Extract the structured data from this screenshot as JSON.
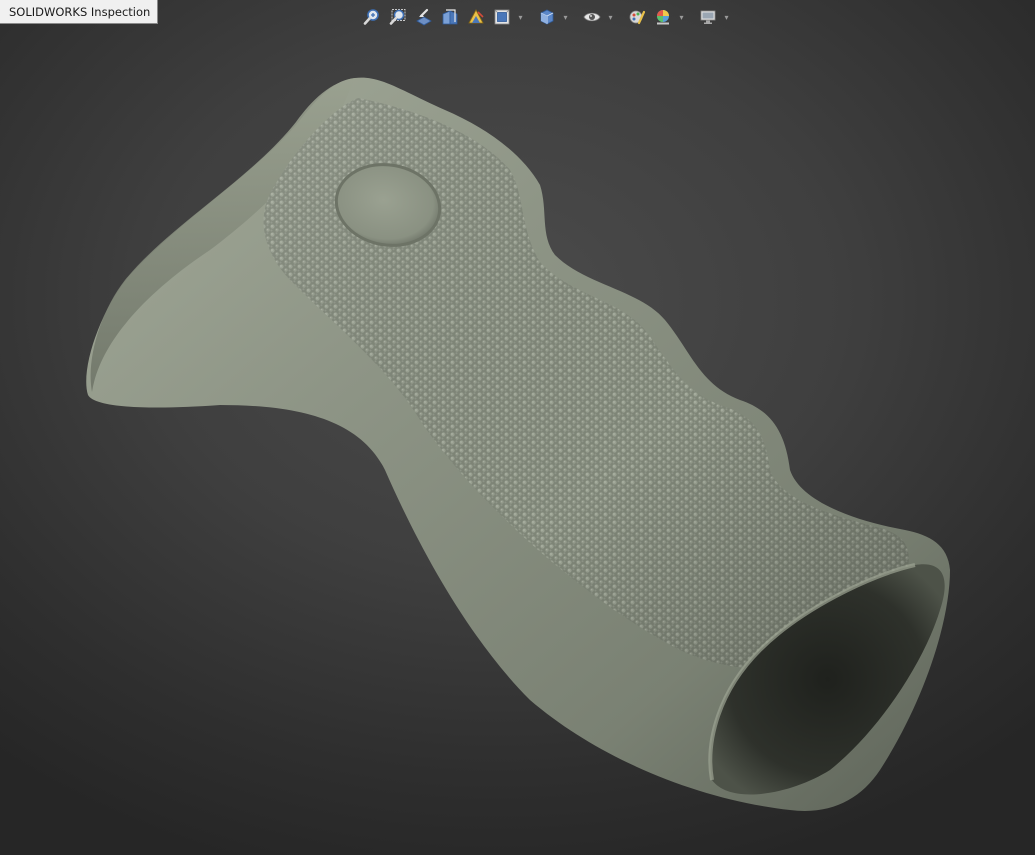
{
  "window": {
    "title": "SOLIDWORKS Inspection"
  },
  "toolbar": {
    "buttons": [
      {
        "icon": "zoom-to-fit-icon"
      },
      {
        "icon": "zoom-to-area-icon"
      },
      {
        "icon": "previous-view-icon"
      },
      {
        "icon": "section-view-icon"
      },
      {
        "icon": "dynamic-annotation-views-icon"
      },
      {
        "icon": "view-orientation-icon",
        "has_dropdown": true
      },
      {
        "icon": "display-style-icon",
        "has_dropdown": true
      },
      {
        "icon": "hide-show-items-icon",
        "has_dropdown": true
      },
      {
        "icon": "edit-appearance-icon"
      },
      {
        "icon": "apply-scene-icon",
        "has_dropdown": true
      },
      {
        "icon": "view-settings-icon",
        "has_dropdown": true
      }
    ],
    "dropdown_glyph": "▾"
  },
  "model": {
    "name": "textured pistol grip",
    "color": "#8e9586",
    "texture_color": "#7d8476",
    "background_center": "#4b4b4b",
    "background_edge": "#262626"
  }
}
